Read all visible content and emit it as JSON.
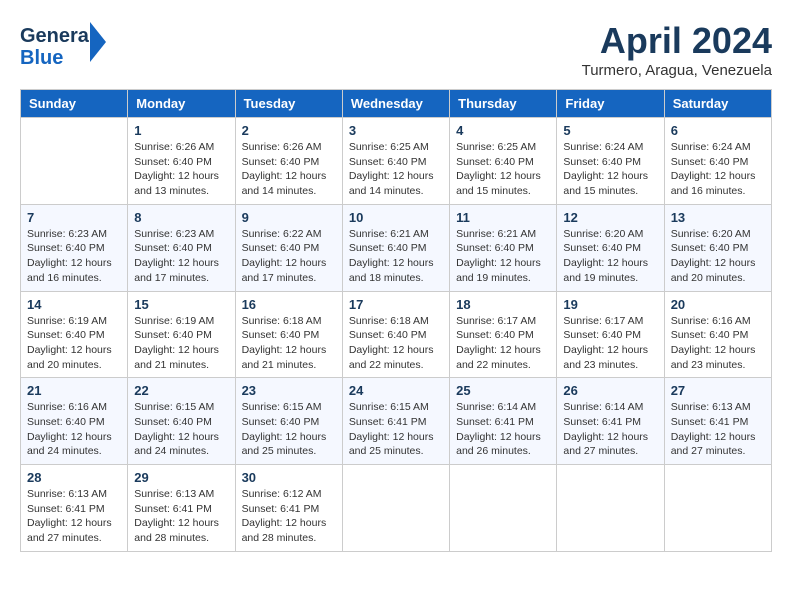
{
  "header": {
    "logo_general": "General",
    "logo_blue": "Blue",
    "title": "April 2024",
    "location": "Turmero, Aragua, Venezuela"
  },
  "days_of_week": [
    "Sunday",
    "Monday",
    "Tuesday",
    "Wednesday",
    "Thursday",
    "Friday",
    "Saturday"
  ],
  "weeks": [
    [
      {
        "day": "",
        "sunrise": "",
        "sunset": "",
        "daylight": ""
      },
      {
        "day": "1",
        "sunrise": "Sunrise: 6:26 AM",
        "sunset": "Sunset: 6:40 PM",
        "daylight": "Daylight: 12 hours and 13 minutes."
      },
      {
        "day": "2",
        "sunrise": "Sunrise: 6:26 AM",
        "sunset": "Sunset: 6:40 PM",
        "daylight": "Daylight: 12 hours and 14 minutes."
      },
      {
        "day": "3",
        "sunrise": "Sunrise: 6:25 AM",
        "sunset": "Sunset: 6:40 PM",
        "daylight": "Daylight: 12 hours and 14 minutes."
      },
      {
        "day": "4",
        "sunrise": "Sunrise: 6:25 AM",
        "sunset": "Sunset: 6:40 PM",
        "daylight": "Daylight: 12 hours and 15 minutes."
      },
      {
        "day": "5",
        "sunrise": "Sunrise: 6:24 AM",
        "sunset": "Sunset: 6:40 PM",
        "daylight": "Daylight: 12 hours and 15 minutes."
      },
      {
        "day": "6",
        "sunrise": "Sunrise: 6:24 AM",
        "sunset": "Sunset: 6:40 PM",
        "daylight": "Daylight: 12 hours and 16 minutes."
      }
    ],
    [
      {
        "day": "7",
        "sunrise": "Sunrise: 6:23 AM",
        "sunset": "Sunset: 6:40 PM",
        "daylight": "Daylight: 12 hours and 16 minutes."
      },
      {
        "day": "8",
        "sunrise": "Sunrise: 6:23 AM",
        "sunset": "Sunset: 6:40 PM",
        "daylight": "Daylight: 12 hours and 17 minutes."
      },
      {
        "day": "9",
        "sunrise": "Sunrise: 6:22 AM",
        "sunset": "Sunset: 6:40 PM",
        "daylight": "Daylight: 12 hours and 17 minutes."
      },
      {
        "day": "10",
        "sunrise": "Sunrise: 6:21 AM",
        "sunset": "Sunset: 6:40 PM",
        "daylight": "Daylight: 12 hours and 18 minutes."
      },
      {
        "day": "11",
        "sunrise": "Sunrise: 6:21 AM",
        "sunset": "Sunset: 6:40 PM",
        "daylight": "Daylight: 12 hours and 19 minutes."
      },
      {
        "day": "12",
        "sunrise": "Sunrise: 6:20 AM",
        "sunset": "Sunset: 6:40 PM",
        "daylight": "Daylight: 12 hours and 19 minutes."
      },
      {
        "day": "13",
        "sunrise": "Sunrise: 6:20 AM",
        "sunset": "Sunset: 6:40 PM",
        "daylight": "Daylight: 12 hours and 20 minutes."
      }
    ],
    [
      {
        "day": "14",
        "sunrise": "Sunrise: 6:19 AM",
        "sunset": "Sunset: 6:40 PM",
        "daylight": "Daylight: 12 hours and 20 minutes."
      },
      {
        "day": "15",
        "sunrise": "Sunrise: 6:19 AM",
        "sunset": "Sunset: 6:40 PM",
        "daylight": "Daylight: 12 hours and 21 minutes."
      },
      {
        "day": "16",
        "sunrise": "Sunrise: 6:18 AM",
        "sunset": "Sunset: 6:40 PM",
        "daylight": "Daylight: 12 hours and 21 minutes."
      },
      {
        "day": "17",
        "sunrise": "Sunrise: 6:18 AM",
        "sunset": "Sunset: 6:40 PM",
        "daylight": "Daylight: 12 hours and 22 minutes."
      },
      {
        "day": "18",
        "sunrise": "Sunrise: 6:17 AM",
        "sunset": "Sunset: 6:40 PM",
        "daylight": "Daylight: 12 hours and 22 minutes."
      },
      {
        "day": "19",
        "sunrise": "Sunrise: 6:17 AM",
        "sunset": "Sunset: 6:40 PM",
        "daylight": "Daylight: 12 hours and 23 minutes."
      },
      {
        "day": "20",
        "sunrise": "Sunrise: 6:16 AM",
        "sunset": "Sunset: 6:40 PM",
        "daylight": "Daylight: 12 hours and 23 minutes."
      }
    ],
    [
      {
        "day": "21",
        "sunrise": "Sunrise: 6:16 AM",
        "sunset": "Sunset: 6:40 PM",
        "daylight": "Daylight: 12 hours and 24 minutes."
      },
      {
        "day": "22",
        "sunrise": "Sunrise: 6:15 AM",
        "sunset": "Sunset: 6:40 PM",
        "daylight": "Daylight: 12 hours and 24 minutes."
      },
      {
        "day": "23",
        "sunrise": "Sunrise: 6:15 AM",
        "sunset": "Sunset: 6:40 PM",
        "daylight": "Daylight: 12 hours and 25 minutes."
      },
      {
        "day": "24",
        "sunrise": "Sunrise: 6:15 AM",
        "sunset": "Sunset: 6:41 PM",
        "daylight": "Daylight: 12 hours and 25 minutes."
      },
      {
        "day": "25",
        "sunrise": "Sunrise: 6:14 AM",
        "sunset": "Sunset: 6:41 PM",
        "daylight": "Daylight: 12 hours and 26 minutes."
      },
      {
        "day": "26",
        "sunrise": "Sunrise: 6:14 AM",
        "sunset": "Sunset: 6:41 PM",
        "daylight": "Daylight: 12 hours and 27 minutes."
      },
      {
        "day": "27",
        "sunrise": "Sunrise: 6:13 AM",
        "sunset": "Sunset: 6:41 PM",
        "daylight": "Daylight: 12 hours and 27 minutes."
      }
    ],
    [
      {
        "day": "28",
        "sunrise": "Sunrise: 6:13 AM",
        "sunset": "Sunset: 6:41 PM",
        "daylight": "Daylight: 12 hours and 27 minutes."
      },
      {
        "day": "29",
        "sunrise": "Sunrise: 6:13 AM",
        "sunset": "Sunset: 6:41 PM",
        "daylight": "Daylight: 12 hours and 28 minutes."
      },
      {
        "day": "30",
        "sunrise": "Sunrise: 6:12 AM",
        "sunset": "Sunset: 6:41 PM",
        "daylight": "Daylight: 12 hours and 28 minutes."
      },
      {
        "day": "",
        "sunrise": "",
        "sunset": "",
        "daylight": ""
      },
      {
        "day": "",
        "sunrise": "",
        "sunset": "",
        "daylight": ""
      },
      {
        "day": "",
        "sunrise": "",
        "sunset": "",
        "daylight": ""
      },
      {
        "day": "",
        "sunrise": "",
        "sunset": "",
        "daylight": ""
      }
    ]
  ]
}
